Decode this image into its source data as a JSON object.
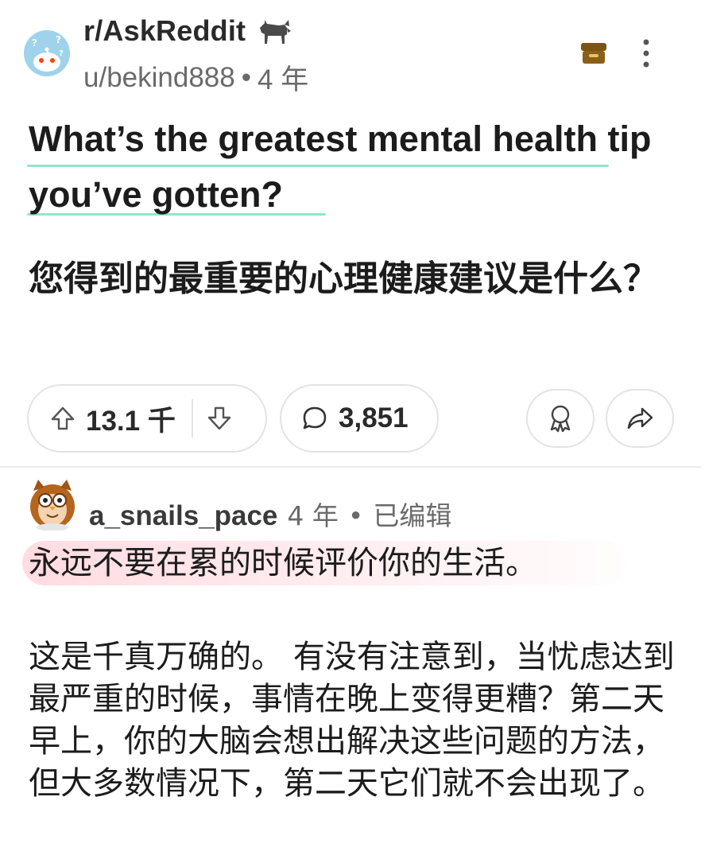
{
  "post": {
    "subreddit": "r/AskReddit",
    "subreddit_icon": "donkey-icon",
    "author": "u/bekind888",
    "separator": "•",
    "age": "4 年",
    "title_en": "What’s the greatest mental health tip you’ve gotten?",
    "title_zh": "您得到的最重要的心理健康建议是什么？",
    "highlight_color": "#8fe6cf"
  },
  "actions": {
    "upvotes": "13.1 千",
    "comments": "3,851",
    "upvote_icon": "upvote-arrow-icon",
    "downvote_icon": "downvote-arrow-icon",
    "comment_icon": "speech-bubble-icon",
    "award_icon": "award-icon",
    "share_icon": "share-arrow-icon",
    "save_icon": "archive-box-icon",
    "more_icon": "vertical-ellipsis-icon"
  },
  "comment": {
    "username": "a_snails_pace",
    "age": "4 年",
    "separator": "•",
    "edited": "已编辑",
    "first_line": "永远不要在累的时候评价你的生活。",
    "first_line_highlight": "#ffc0c8",
    "body": "这是千真万确的。 有没有注意到，当忧虑达到最严重的时候，事情在晚上变得更糟？第二天早上，你的大脑会想出解决这些问题的方法，但大多数情况下，第二天它们就不会出现了。"
  }
}
